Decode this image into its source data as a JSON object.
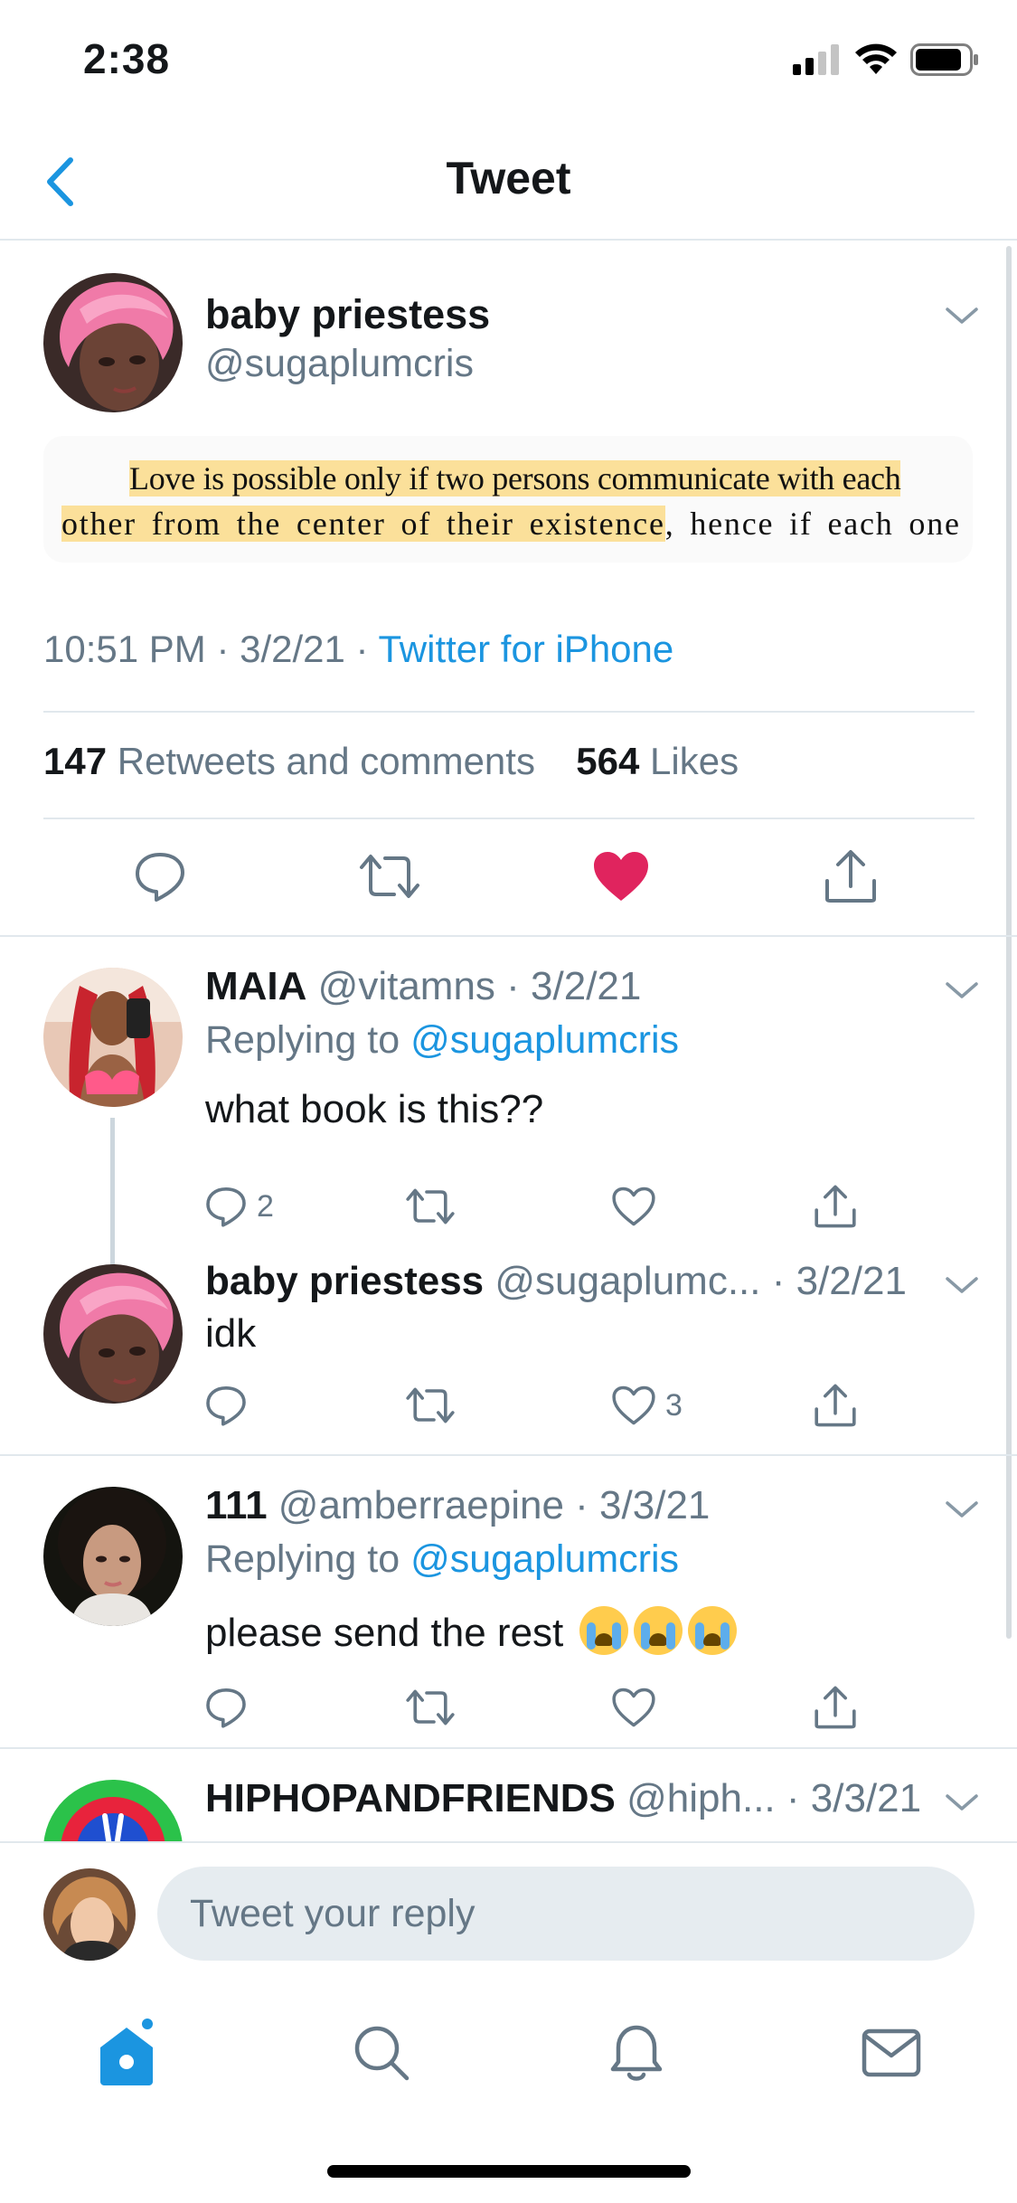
{
  "status_bar": {
    "time": "2:38"
  },
  "nav": {
    "title": "Tweet"
  },
  "main_tweet": {
    "name": "baby priestess",
    "handle": "@sugaplumcris",
    "quote_line1": "Love is possible only if two persons communicate with each",
    "quote_line2_highlight": "other from the center of their existence",
    "quote_line2_rest": ", hence if each one of",
    "time": "10:51 PM · 3/2/21 · ",
    "source": "Twitter for iPhone",
    "retweets_count": "147",
    "retweets_label": " Retweets and comments",
    "likes_count": "564",
    "likes_label": " Likes",
    "liked": true
  },
  "replies": [
    {
      "name": "MAIA",
      "handle_date": " @vitamns · 3/2/21",
      "replying_prefix": "Replying to ",
      "replying_to": "@sugaplumcris",
      "text": "what book is this??",
      "reply_count": "2",
      "like_count": ""
    },
    {
      "name": "baby priestess",
      "handle_date": " @sugaplumc... · 3/2/21",
      "text": "idk",
      "reply_count": "",
      "like_count": "3"
    },
    {
      "name": "111",
      "handle_date": " @amberraepine · 3/3/21",
      "replying_prefix": "Replying to ",
      "replying_to": "@sugaplumcris",
      "text": "please send the rest ",
      "emojis": [
        "loudly-crying-face",
        "loudly-crying-face",
        "loudly-crying-face"
      ]
    },
    {
      "name": "HIPHOPANDFRIENDS",
      "handle_date": " @hiph... · 3/3/21"
    }
  ],
  "reply_bar": {
    "placeholder": "Tweet your reply"
  },
  "tabs": [
    "home-icon",
    "search-icon",
    "notifications-icon",
    "messages-icon"
  ],
  "colors": {
    "accent": "#1b95e0",
    "like": "#e0245e",
    "highlight": "#fbe09a",
    "muted": "#657786"
  }
}
